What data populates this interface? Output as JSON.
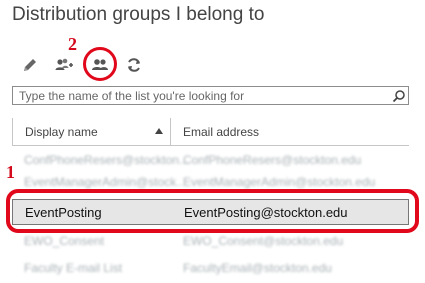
{
  "page": {
    "title": "Distribution groups I belong to"
  },
  "toolbar": {
    "buttons": [
      {
        "name": "edit",
        "icon": "pencil-icon"
      },
      {
        "name": "join",
        "icon": "people-add-icon"
      },
      {
        "name": "groups",
        "icon": "people-icon"
      },
      {
        "name": "refresh",
        "icon": "refresh-icon"
      }
    ]
  },
  "annotations": {
    "step1": "1",
    "step2": "2",
    "color": "#e0081a"
  },
  "search": {
    "placeholder": "Type the name of the list you're looking for",
    "value": ""
  },
  "table": {
    "columns": {
      "display_name": "Display name",
      "email": "Email address"
    },
    "rows": [
      {
        "name": "ConfPhoneResers@stockton...",
        "email": "ConfPhoneResers@stockton.edu"
      },
      {
        "name": "EventManagerAdmin@stock...",
        "email": "EventManagerAdmin@stockton.edu"
      },
      {
        "name": "EventPosting",
        "email": "EventPosting@stockton.edu"
      },
      {
        "name": "EWO_Consent",
        "email": "EWO_Consent@stockton.edu"
      },
      {
        "name": "Faculty E-mail List",
        "email": "FacultyEmail@stockton.edu"
      }
    ],
    "selected_index": 2
  }
}
